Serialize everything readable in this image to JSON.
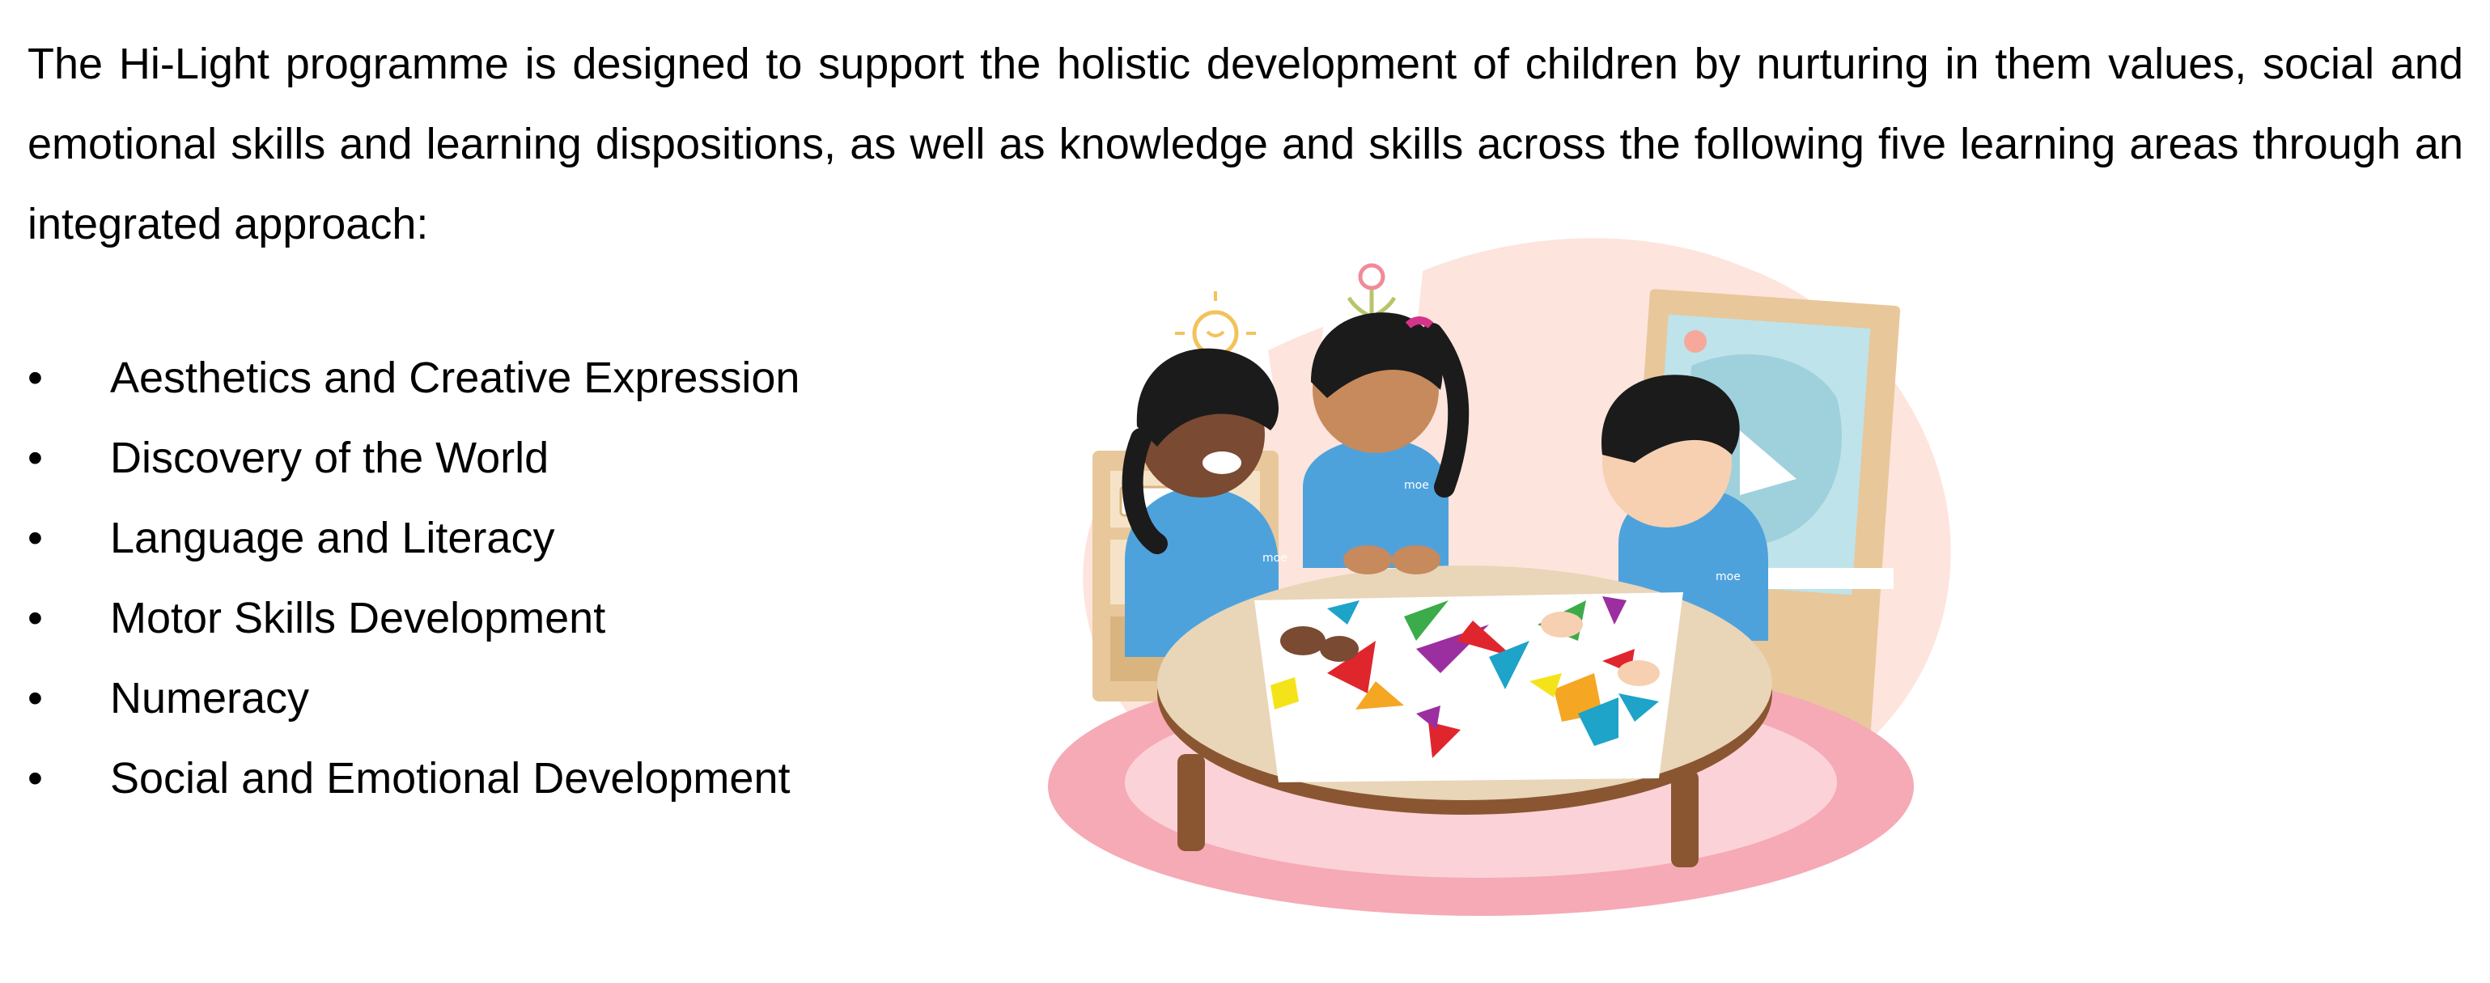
{
  "intro": {
    "paragraph": "The Hi-Light programme is designed to support the holistic development of children by nurturing in them values, social and emotional skills and learning dispositions, as well as knowledge and skills across the following five learning areas through an integrated approach:"
  },
  "learning_areas": {
    "bullet": "•",
    "items": [
      "Aesthetics and Creative Expression",
      "Discovery of the World",
      "Language and Literacy",
      "Motor Skills Development",
      "Numeracy",
      "Social and Emotional Development"
    ]
  },
  "illustration": {
    "shirt_logo": "moe",
    "colors": {
      "background_blob": "#fde4dc",
      "rug_outer": "#f5aab6",
      "rug_inner": "#fcd2d9",
      "table_top": "#e9d5b8",
      "table_edge": "#8a5632",
      "shirt": "#4ea2dc",
      "easel": "#e8c79a"
    }
  }
}
